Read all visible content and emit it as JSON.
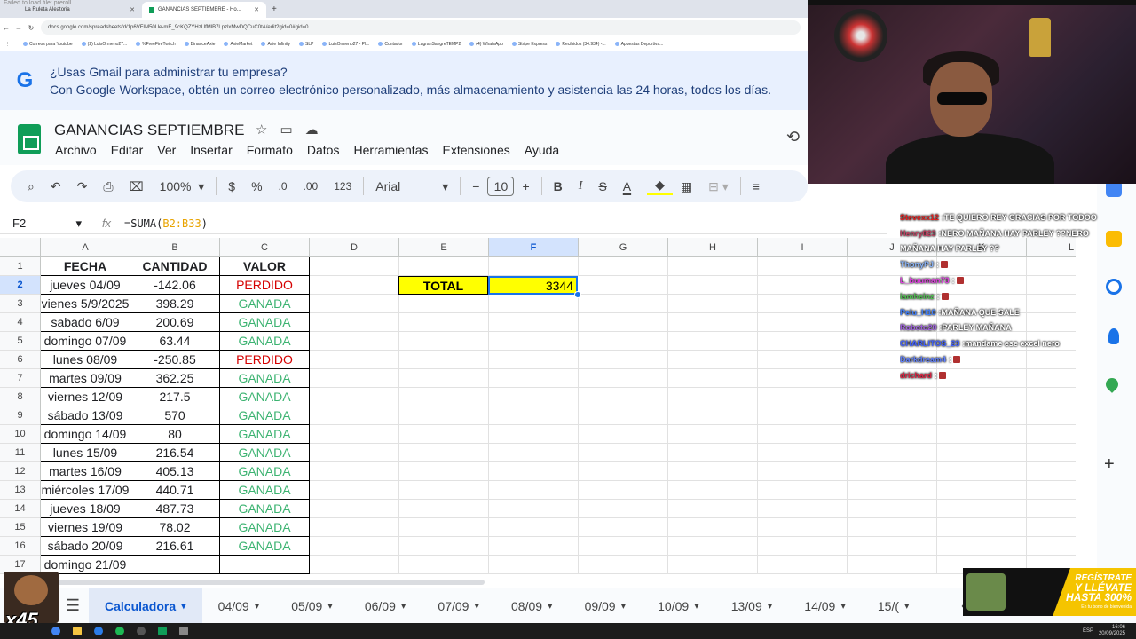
{
  "browser": {
    "failed_text": "Failed to load file: preroll",
    "tabs": [
      {
        "label": "La Ruleta Aleatoria"
      },
      {
        "label": "GANANCIAS SEPTIEMBRE - Ho..."
      }
    ],
    "url": "docs.google.com/spreadsheets/d/1p6VFIM50Ue-mE_9cKQZYHzUfMlB7LpzlxMwDQCuC0tA/edit?gid=0#gid=0",
    "bookmarks": [
      "Correos para Youtube",
      "(2) LuisOrmeno27...",
      "%FreeFireTwitch",
      "BinanceAxie",
      "AxieMarket",
      "Axie Infinity",
      "SLP",
      "LuisOrmeno27 - Pl...",
      "Contador",
      "LagranSangreTEMP2",
      "(4) WhatsApp",
      "Stripe Express",
      "Recibidos (34.934) -...",
      "Apuestas Deportiva..."
    ]
  },
  "banner": {
    "logo": "G",
    "line1": "¿Usas Gmail para administrar tu empresa?",
    "line2": "Con Google Workspace, obtén un correo electrónico personalizado, más almacenamiento y asistencia las 24 horas, todos los días."
  },
  "doc": {
    "title": "GANANCIAS SEPTIEMBRE",
    "menu": [
      "Archivo",
      "Editar",
      "Ver",
      "Insertar",
      "Formato",
      "Datos",
      "Herramientas",
      "Extensiones",
      "Ayuda"
    ]
  },
  "toolbar": {
    "zoom": "100%",
    "currency": "$",
    "percent": "%",
    "dec_down": ".0",
    "dec_up": ".00",
    "number_format": "123",
    "font": "Arial",
    "font_size": "10",
    "bold": "B",
    "italic": "I",
    "strike": "S",
    "text_color": "A"
  },
  "formula_bar": {
    "cell_ref": "F2",
    "fx": "fx",
    "formula_prefix": "=SUMA(",
    "formula_range": "B2:B33",
    "formula_suffix": ")"
  },
  "grid": {
    "columns": [
      "A",
      "B",
      "C",
      "D",
      "E",
      "F",
      "G",
      "H",
      "I",
      "J",
      "K",
      "L"
    ],
    "selected_column": "F",
    "selected_row": "2",
    "headers": {
      "a": "FECHA",
      "b": "CANTIDAD",
      "c": "VALOR"
    },
    "rows": [
      {
        "n": "2",
        "fecha": "jueves 04/09",
        "cantidad": "-142.06",
        "valor": "PERDIDO"
      },
      {
        "n": "3",
        "fecha": "vienes 5/9/2025",
        "cantidad": "398.29",
        "valor": "GANADA"
      },
      {
        "n": "4",
        "fecha": "sabado 6/09",
        "cantidad": "200.69",
        "valor": "GANADA"
      },
      {
        "n": "5",
        "fecha": "domingo 07/09",
        "cantidad": "63.44",
        "valor": "GANADA"
      },
      {
        "n": "6",
        "fecha": "lunes 08/09",
        "cantidad": "-250.85",
        "valor": "PERDIDO"
      },
      {
        "n": "7",
        "fecha": "martes 09/09",
        "cantidad": "362.25",
        "valor": "GANADA"
      },
      {
        "n": "8",
        "fecha": "viernes 12/09",
        "cantidad": "217.5",
        "valor": "GANADA"
      },
      {
        "n": "9",
        "fecha": "sábado 13/09",
        "cantidad": "570",
        "valor": "GANADA"
      },
      {
        "n": "10",
        "fecha": "domingo 14/09",
        "cantidad": "80",
        "valor": "GANADA"
      },
      {
        "n": "11",
        "fecha": "lunes 15/09",
        "cantidad": "216.54",
        "valor": "GANADA"
      },
      {
        "n": "12",
        "fecha": "martes 16/09",
        "cantidad": "405.13",
        "valor": "GANADA"
      },
      {
        "n": "13",
        "fecha": "miércoles 17/09",
        "cantidad": "440.71",
        "valor": "GANADA"
      },
      {
        "n": "14",
        "fecha": "jueves 18/09",
        "cantidad": "487.73",
        "valor": "GANADA"
      },
      {
        "n": "15",
        "fecha": "viernes 19/09",
        "cantidad": "78.02",
        "valor": "GANADA"
      },
      {
        "n": "16",
        "fecha": "sábado 20/09",
        "cantidad": "216.61",
        "valor": "GANADA"
      },
      {
        "n": "17",
        "fecha": "domingo 21/09",
        "cantidad": "",
        "valor": ""
      }
    ],
    "total_label": "TOTAL",
    "total_value": "3344"
  },
  "sheet_tabs": [
    "Calculadora",
    "04/09",
    "05/09",
    "06/09",
    "07/09",
    "08/09",
    "09/09",
    "10/09",
    "13/09",
    "14/09",
    "15/("
  ],
  "active_sheet": "Calculadora",
  "chat": [
    {
      "user": "Stevexx12",
      "msg": "TE QUIERO REY GRACIAS POR TODOO",
      "color": "#e02020"
    },
    {
      "user": "Henry823",
      "msg": "NERO MAÑANA HAY PARLEY ??NERO",
      "color": "#c04060"
    },
    {
      "user": "",
      "msg": "MAÑANA HAY PARLEY ??",
      "color": "#ffffff"
    },
    {
      "user": "ThonyPJ",
      "msg": "",
      "color": "#8ab4f8"
    },
    {
      "user": "L_buuman73",
      "msg": "",
      "color": "#e040e0"
    },
    {
      "user": "iamheinz",
      "msg": "",
      "color": "#50c050"
    },
    {
      "user": "Pelu_H10",
      "msg": "MAÑANA QUE SALE",
      "color": "#4080ff"
    },
    {
      "user": "Roboto20",
      "msg": "PARLEY MAÑANA",
      "color": "#a060e0"
    },
    {
      "user": "CHARLITOS_23",
      "msg": "mandame ese excel nero",
      "color": "#4060ff"
    },
    {
      "user": "Darkdream4",
      "msg": "",
      "color": "#6080ff"
    },
    {
      "user": "drichard",
      "msg": "",
      "color": "#e02040"
    }
  ],
  "ad": {
    "line1": "REGÍSTRATE",
    "line2": "Y LLÉVATE",
    "line3": "HASTA 300%",
    "line4": "En tu bono de bienvenida"
  },
  "overlay": {
    "multiplier": "x45"
  },
  "taskbar": {
    "lang": "ESP",
    "time": "16:06",
    "date": "20/09/2025"
  },
  "colors": {
    "accent": "#1a73e8",
    "yellow": "#ffff00",
    "lost": "#d50000",
    "won": "#3cb371"
  }
}
